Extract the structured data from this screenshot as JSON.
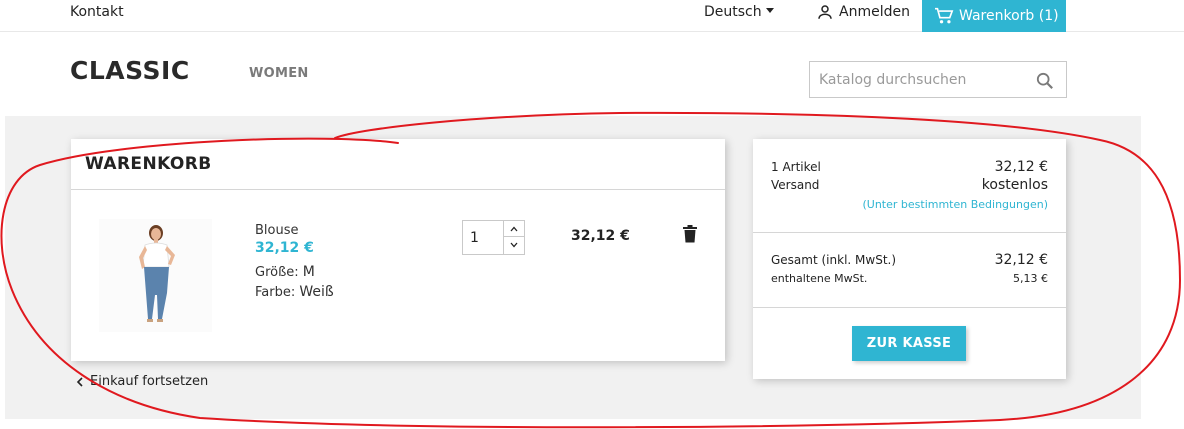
{
  "topbar": {
    "contact": "Kontakt",
    "language": "Deutsch",
    "login": "Anmelden",
    "cart": "Warenkorb (1)"
  },
  "header": {
    "logo": "CLASSIC",
    "nav_women": "WOMEN",
    "search_placeholder": "Katalog durchsuchen"
  },
  "cart": {
    "title": "WARENKORB",
    "item": {
      "name": "Blouse",
      "price": "32,12 €",
      "size_label": "Größe:",
      "size_value": "M",
      "color_label": "Farbe:",
      "color_value": "Weiß",
      "quantity": "1",
      "line_total": "32,12 €"
    },
    "continue": "Einkauf fortsetzen"
  },
  "summary": {
    "items_label": "1 Artikel",
    "items_value": "32,12 €",
    "shipping_label": "Versand",
    "shipping_value": "kostenlos",
    "conditions": "(Unter bestimmten Bedingungen)",
    "total_label": "Gesamt (inkl. MwSt.)",
    "total_value": "32,12 €",
    "tax_label": "enthaltene MwSt.",
    "tax_value": "5,13 €",
    "checkout": "ZUR KASSE"
  },
  "colors": {
    "accent": "#2fb5d2",
    "annotation": "#e0191f",
    "background_gray": "#f1f1f1"
  }
}
